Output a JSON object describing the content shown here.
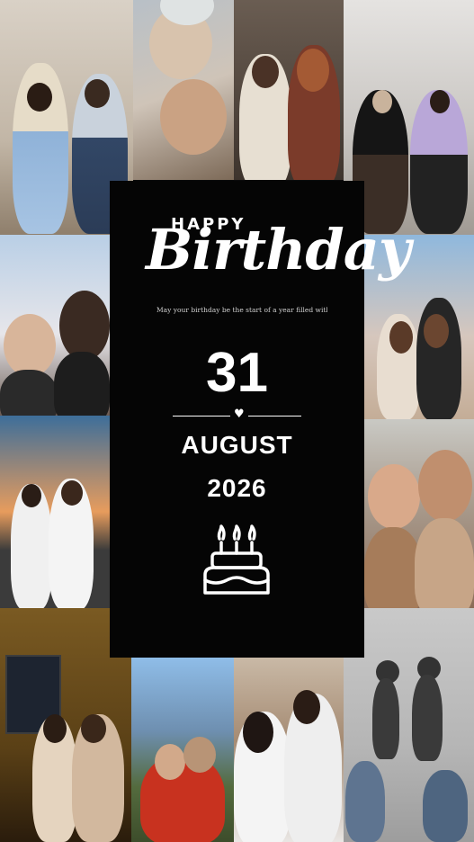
{
  "card": {
    "happy": "HAPPY",
    "birthday": "Birthday",
    "message": "May your birthday be the start of a year filled with good luck, good health, and much happiness",
    "day": "31",
    "heart": "♥",
    "month": "AUGUST",
    "year": "2026",
    "cake_icon": "birthday-cake-icon",
    "text_color": "#ffffff",
    "background_color": "#050505"
  }
}
